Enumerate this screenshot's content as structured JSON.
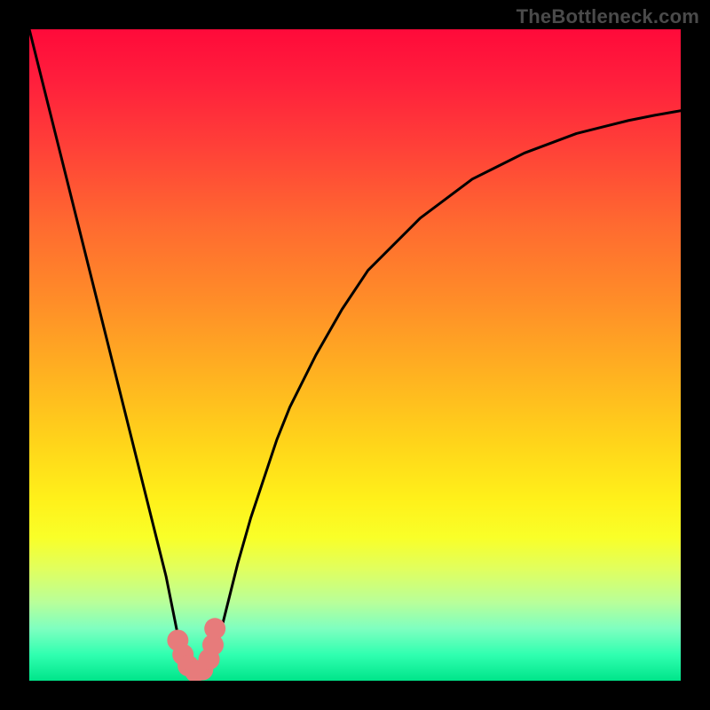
{
  "watermark": "TheBottleneck.com",
  "chart_data": {
    "type": "line",
    "title": "",
    "xlabel": "",
    "ylabel": "",
    "xlim": [
      0,
      100
    ],
    "ylim": [
      0,
      100
    ],
    "series": [
      {
        "name": "curve",
        "x": [
          0,
          2,
          4,
          6,
          8,
          10,
          12,
          14,
          16,
          18,
          20,
          21,
          22,
          23,
          24,
          25,
          26,
          27,
          28,
          29,
          30,
          32,
          34,
          36,
          38,
          40,
          44,
          48,
          52,
          56,
          60,
          64,
          68,
          72,
          76,
          80,
          84,
          88,
          92,
          96,
          100
        ],
        "y": [
          100,
          92,
          84,
          76,
          68,
          60,
          52,
          44,
          36,
          28,
          20,
          16,
          11,
          6,
          3,
          1,
          0,
          1,
          3,
          6,
          10,
          18,
          25,
          31,
          37,
          42,
          50,
          57,
          63,
          67,
          71,
          74,
          77,
          79,
          81,
          82.5,
          84,
          85,
          86,
          86.8,
          87.5
        ]
      }
    ],
    "markers": {
      "name": "highlight-points",
      "x": [
        22.8,
        23.6,
        24.4,
        25.5,
        26.6,
        27.6,
        28.2,
        28.5
      ],
      "y": [
        6.2,
        4.0,
        2.3,
        1.4,
        1.7,
        3.3,
        5.5,
        8.0
      ]
    },
    "colors": {
      "curve": "#000000",
      "marker": "#e77b7b",
      "gradient_top": "#ff0a3a",
      "gradient_bottom": "#00e58a"
    }
  }
}
